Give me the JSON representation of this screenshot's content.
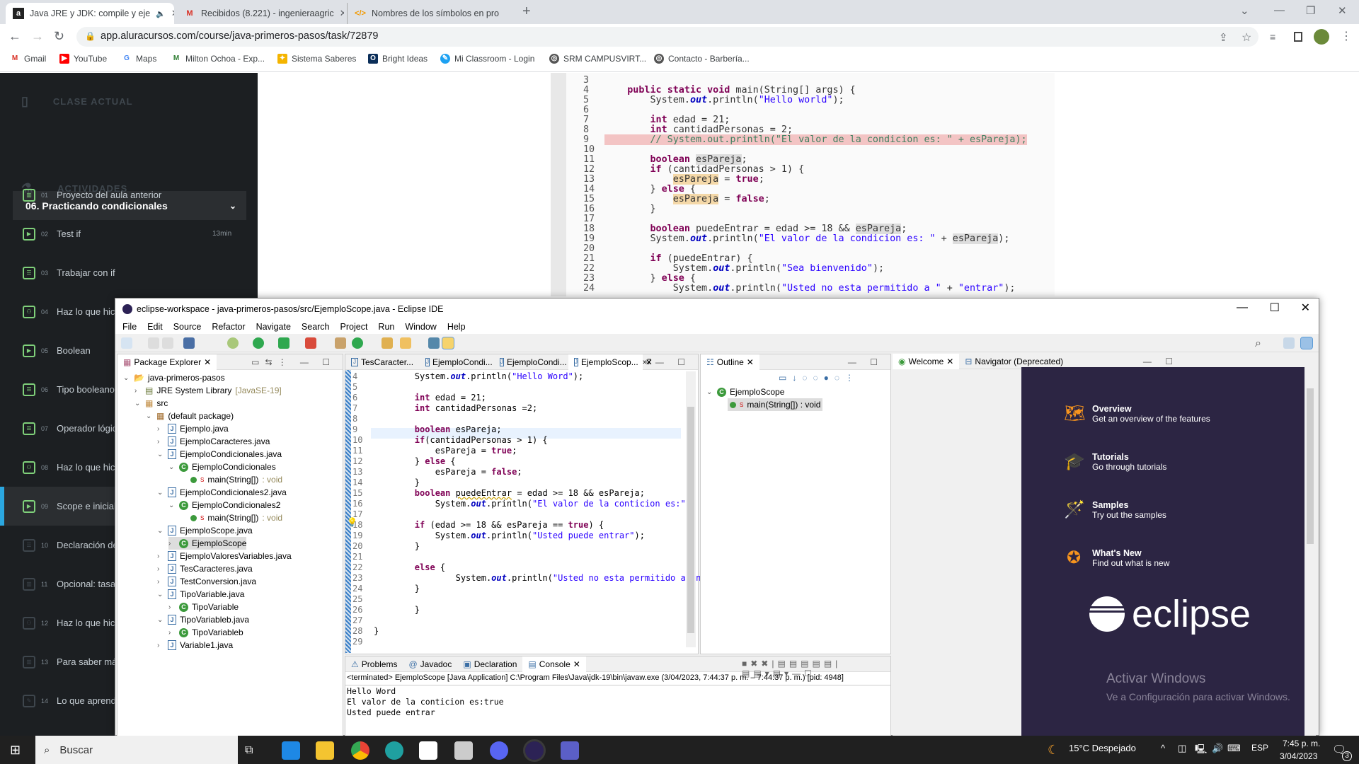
{
  "browser": {
    "tabs": [
      {
        "title": "Java JRE y JDK: compile y eje",
        "icon": "alura-icon",
        "active": true,
        "audio": true
      },
      {
        "title": "Recibidos (8.221) - ingenieraagric",
        "icon": "gmail-icon"
      },
      {
        "title": "Nombres de los símbolos en pro",
        "icon": "code-icon"
      }
    ],
    "new_tab_label": "+",
    "url": "app.aluracursos.com/course/java-primeros-pasos/task/72879",
    "bookmarks": [
      "Gmail",
      "YouTube",
      "Maps",
      "Milton Ochoa - Exp...",
      "Sistema Saberes",
      "Bright Ideas",
      "Mi Classroom - Login",
      "SRM CAMPUSVIRT...",
      "Contacto - Barbería..."
    ]
  },
  "alura": {
    "current_section_label": "CLASE ACTUAL",
    "current_class": "06. Practicando condicionales",
    "activities_label": "ACTIVIDADES",
    "activities": [
      {
        "num": "01",
        "title": "Proyecto del aula anterior",
        "icon": "book-icon",
        "done": true
      },
      {
        "num": "02",
        "title": "Test if",
        "icon": "video-icon",
        "done": true,
        "duration": "13min"
      },
      {
        "num": "03",
        "title": "Trabajar con if",
        "icon": "list-icon",
        "done": true
      },
      {
        "num": "04",
        "title": "Haz lo que hici",
        "icon": "people-icon",
        "done": true
      },
      {
        "num": "05",
        "title": "Boolean",
        "icon": "video-icon",
        "done": true
      },
      {
        "num": "06",
        "title": "Tipo booleano",
        "icon": "list-icon",
        "done": true
      },
      {
        "num": "07",
        "title": "Operador lógic",
        "icon": "list-icon",
        "done": true
      },
      {
        "num": "08",
        "title": "Haz lo que hici",
        "icon": "people-icon",
        "done": true
      },
      {
        "num": "09",
        "title": "Scope e iniciali",
        "icon": "video-icon",
        "done": true,
        "current": true
      },
      {
        "num": "10",
        "title": "Declaración de",
        "icon": "list-icon",
        "done": false
      },
      {
        "num": "11",
        "title": "Opcional: tasa",
        "icon": "book-icon",
        "done": false
      },
      {
        "num": "12",
        "title": "Haz lo que hici variables",
        "icon": "people-icon",
        "done": false
      },
      {
        "num": "13",
        "title": "Para saber más",
        "icon": "book-icon",
        "done": false
      },
      {
        "num": "14",
        "title": "Lo que aprend",
        "icon": "user-edit-icon",
        "done": false
      }
    ]
  },
  "video": {
    "lines": [
      {
        "n": "3",
        "code": ""
      },
      {
        "n": "4",
        "code": "    public static void main(String[] args) {"
      },
      {
        "n": "5",
        "code": "        System.out.println(\"Hello world\");"
      },
      {
        "n": "6",
        "code": ""
      },
      {
        "n": "7",
        "code": "        int edad = 21;"
      },
      {
        "n": "8",
        "code": "        int cantidadPersonas = 2;"
      },
      {
        "n": "9",
        "code": "        // System.out.println(\"El valor de la condicion es: \" + esPareja);"
      },
      {
        "n": "10",
        "code": ""
      },
      {
        "n": "11",
        "code": "        boolean esPareja;"
      },
      {
        "n": "12",
        "code": "        if (cantidadPersonas > 1) {"
      },
      {
        "n": "13",
        "code": "            esPareja = true;"
      },
      {
        "n": "14",
        "code": "        } else {"
      },
      {
        "n": "15",
        "code": "            esPareja = false;"
      },
      {
        "n": "16",
        "code": "        }"
      },
      {
        "n": "17",
        "code": ""
      },
      {
        "n": "18",
        "code": "        boolean puedeEntrar = edad >= 18 && esPareja;"
      },
      {
        "n": "19",
        "code": "        System.out.println(\"El valor de la condicion es: \" + esPareja);"
      },
      {
        "n": "20",
        "code": ""
      },
      {
        "n": "21",
        "code": "        if (puedeEntrar) {"
      },
      {
        "n": "22",
        "code": "            System.out.println(\"Sea bienvenido\");"
      },
      {
        "n": "23",
        "code": "        } else {"
      },
      {
        "n": "24",
        "code": "            System.out.println(\"Usted no esta permitido a \" + \"entrar\");"
      }
    ]
  },
  "eclipse": {
    "title": "eclipse-workspace - java-primeros-pasos/src/EjemploScope.java - Eclipse IDE",
    "menu": [
      "File",
      "Edit",
      "Source",
      "Refactor",
      "Navigate",
      "Search",
      "Project",
      "Run",
      "Window",
      "Help"
    ],
    "package_explorer": {
      "tab": "Package Explorer",
      "tree": [
        {
          "label": "java-primeros-pasos",
          "level": 0,
          "type": "project",
          "expanded": true
        },
        {
          "label": "JRE System Library",
          "suffix": "[JavaSE-19]",
          "level": 1,
          "type": "library"
        },
        {
          "label": "src",
          "level": 1,
          "type": "folder",
          "expanded": true
        },
        {
          "label": "(default package)",
          "level": 2,
          "type": "package",
          "expanded": true
        },
        {
          "label": "Ejemplo.java",
          "level": 3,
          "type": "java"
        },
        {
          "label": "EjemploCaracteres.java",
          "level": 3,
          "type": "java"
        },
        {
          "label": "EjemploCondicionales.java",
          "level": 3,
          "type": "java",
          "expanded": true
        },
        {
          "label": "EjemploCondicionales",
          "level": 4,
          "type": "class",
          "expanded": true
        },
        {
          "label": "main(String[])",
          "suffix": ": void",
          "level": 5,
          "type": "method"
        },
        {
          "label": "EjemploCondicionales2.java",
          "level": 3,
          "type": "java",
          "expanded": true
        },
        {
          "label": "EjemploCondicionales2",
          "level": 4,
          "type": "class",
          "expanded": true
        },
        {
          "label": "main(String[])",
          "suffix": ": void",
          "level": 5,
          "type": "method"
        },
        {
          "label": "EjemploScope.java",
          "level": 3,
          "type": "java",
          "expanded": true
        },
        {
          "label": "EjemploScope",
          "level": 4,
          "type": "class",
          "selected": true
        },
        {
          "label": "EjemploValoresVariables.java",
          "level": 3,
          "type": "java"
        },
        {
          "label": "TesCaracteres.java",
          "level": 3,
          "type": "java"
        },
        {
          "label": "TestConversion.java",
          "level": 3,
          "type": "java"
        },
        {
          "label": "TipoVariable.java",
          "level": 3,
          "type": "java",
          "expanded": true
        },
        {
          "label": "TipoVariable",
          "level": 4,
          "type": "class"
        },
        {
          "label": "TipoVariableb.java",
          "level": 3,
          "type": "java",
          "expanded": true
        },
        {
          "label": "TipoVariableb",
          "level": 4,
          "type": "class"
        },
        {
          "label": "Variable1.java",
          "level": 3,
          "type": "java"
        }
      ]
    },
    "editor": {
      "tabs": [
        "TesCaracter...",
        "EjemploCondi...",
        "EjemploCondi...",
        "EjemploScop..."
      ],
      "active_tab": 3,
      "overflow": "»7",
      "lines": [
        {
          "n": "4",
          "code": "        System.out.println(\"Hello Word\");"
        },
        {
          "n": "5",
          "code": ""
        },
        {
          "n": "6",
          "code": "        int edad = 21;"
        },
        {
          "n": "7",
          "code": "        int cantidadPersonas =2;"
        },
        {
          "n": "8",
          "code": ""
        },
        {
          "n": "9",
          "code": "        boolean esPareja;"
        },
        {
          "n": "10",
          "code": "        if(cantidadPersonas > 1) {"
        },
        {
          "n": "11",
          "code": "            esPareja = true;"
        },
        {
          "n": "12",
          "code": "        } else {"
        },
        {
          "n": "13",
          "code": "            esPareja = false;"
        },
        {
          "n": "14",
          "code": "        }"
        },
        {
          "n": "15",
          "code": "        boolean puedeEntrar = edad >= 18 && esPareja;"
        },
        {
          "n": "16",
          "code": "            System.out.println(\"El valor de la conticion es:\" + esPareja);"
        },
        {
          "n": "17",
          "code": ""
        },
        {
          "n": "18",
          "code": "        if (edad >= 18 && esPareja == true) {"
        },
        {
          "n": "19",
          "code": "            System.out.println(\"Usted puede entrar\");"
        },
        {
          "n": "20",
          "code": "        }"
        },
        {
          "n": "21",
          "code": ""
        },
        {
          "n": "22",
          "code": "        else {"
        },
        {
          "n": "23",
          "code": "                System.out.println(\"Usted no esta permitido a entrar\");"
        },
        {
          "n": "24",
          "code": "        }"
        },
        {
          "n": "25",
          "code": ""
        },
        {
          "n": "26",
          "code": "        }"
        },
        {
          "n": "27",
          "code": ""
        },
        {
          "n": "28",
          "code": "}"
        },
        {
          "n": "29",
          "code": ""
        }
      ]
    },
    "outline": {
      "tab": "Outline",
      "items": [
        {
          "label": "EjemploScope",
          "level": 0
        },
        {
          "label": "main(String[]) : void",
          "level": 1,
          "selected": true
        }
      ]
    },
    "welcome": {
      "tabs": [
        "Welcome",
        "Navigator (Deprecated)"
      ],
      "items": [
        {
          "title": "Overview",
          "desc": "Get an overview of the features",
          "icon": "map-icon"
        },
        {
          "title": "Tutorials",
          "desc": "Go through tutorials",
          "icon": "graduation-cap-icon"
        },
        {
          "title": "Samples",
          "desc": "Try out the samples",
          "icon": "magic-wand-icon"
        },
        {
          "title": "What's New",
          "desc": "Find out what is new",
          "icon": "star-icon"
        }
      ],
      "logo_text": "eclipse",
      "watermark_title": "Activar Windows",
      "watermark_sub": "Ve a Configuración para activar Windows."
    },
    "console": {
      "tabs": [
        "Problems",
        "Javadoc",
        "Declaration",
        "Console"
      ],
      "active_tab": 3,
      "status": "<terminated> EjemploScope [Java Application] C:\\Program Files\\Java\\jdk-19\\bin\\javaw.exe  (3/04/2023, 7:44:37 p. m. – 7:44:37 p. m.) [pid: 4948]",
      "output": [
        "Hello Word",
        "El valor de la conticion es:true",
        "Usted puede entrar"
      ]
    }
  },
  "taskbar": {
    "search_placeholder": "Buscar",
    "weather": "15°C  Despejado",
    "lang": "ESP",
    "time": "7:45 p. m.",
    "date": "3/04/2023",
    "notifications": "3"
  }
}
